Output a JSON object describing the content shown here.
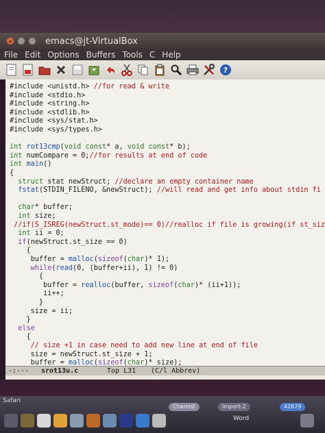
{
  "window": {
    "title": "emacs@jt-VirtualBox"
  },
  "menu": {
    "items": [
      "File",
      "Edit",
      "Options",
      "Buffers",
      "Tools",
      "C",
      "Help"
    ]
  },
  "toolbar": {
    "icons": [
      "new-file-icon",
      "open-file-icon",
      "open-folder-icon",
      "close-buffer-icon",
      "save-icon",
      "save-as-icon",
      "undo-icon",
      "cut-icon",
      "copy-icon",
      "paste-icon",
      "search-icon",
      "print-icon",
      "preferences-icon",
      "help-icon"
    ]
  },
  "code": {
    "lines": [
      "#include <unistd.h> //for read & write",
      "#include <stdio.h>",
      "#include <string.h>",
      "#include <stdlib.h>",
      "#include <sys/stat.h>",
      "#include <sys/types.h>",
      "",
      "int rot13cmp(void const* a, void const* b);",
      "int numCompare = 0;//for results at end of code",
      "int main()",
      "{",
      "  struct stat newStruct; //declare an empty container name",
      "  fstat(STDIN_FILENO, &newStruct); //will read and get info about stdin fi",
      "",
      "  char* buffer;",
      "  int size;",
      " //if(S_ISREG(newStruct.st_mode)== 0)//realloc if file is growing(if st_size",
      "  int ii = 0;",
      "  if(newStruct.st_size == 0)",
      "    {",
      "     buffer = malloc(sizeof(char)* 1);",
      "     while(read(0, (buffer+ii), 1) != 0)",
      "       {",
      "        buffer = realloc(buffer, sizeof(char)* (ii+1));",
      "        ii++;",
      "       }",
      "     size = ii;",
      "    }",
      "  else",
      "    {",
      "     // size +1 in case need to add new line at end of file",
      "     size = newStruct.st_size + 1;",
      "     buffer = malloc(sizeof(char)* size);"
    ]
  },
  "modeline": {
    "status": "-:---",
    "filename": "srot13u.c",
    "position": "Top L31",
    "mode": "(C/l Abbrev)"
  },
  "dock": {
    "label": "Safari",
    "item_chemistry": "Chemist",
    "item_import": "Import-2",
    "badge_count": "42679",
    "item_word": "Word"
  },
  "colors": {
    "keyword": "#7a3fa0",
    "type": "#2a7a2a",
    "comment": "#b11a1a",
    "function": "#1d4ea8",
    "editor_bg": "#f3f1ec"
  }
}
